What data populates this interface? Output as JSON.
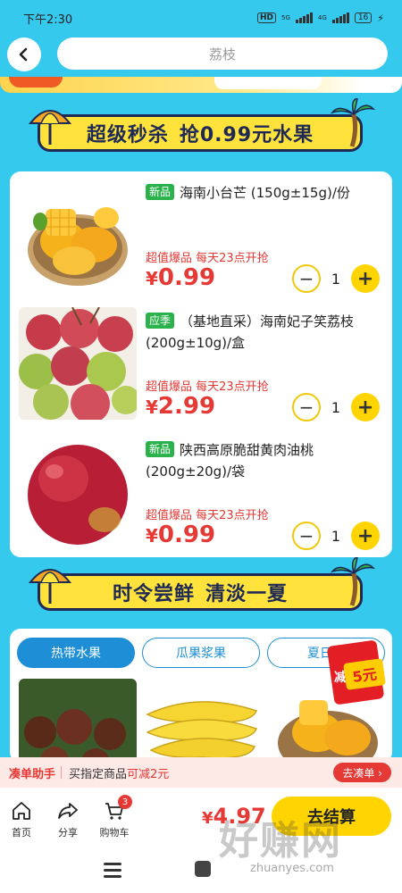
{
  "status_bar": {
    "time": "下午2:30",
    "network_hd": "HD",
    "net1": "5G",
    "net2": "4G",
    "battery": "16"
  },
  "header": {
    "search_text": "荔枝"
  },
  "section1": {
    "title_a": "超级秒杀",
    "title_b": "抢0.99元水果"
  },
  "products": [
    {
      "tag": "新品",
      "name": "海南小台芒 (150g±15g)/份",
      "promo": "超值爆品 每天23点开抢",
      "currency": "¥",
      "price": "0.99",
      "qty": "1",
      "tag_color": "#2bb24c"
    },
    {
      "tag": "应季",
      "name": "（基地直采）海南妃子笑荔枝(200g±10g)/盒",
      "promo": "超值爆品 每天23点开抢",
      "currency": "¥",
      "price": "2.99",
      "qty": "1",
      "tag_color": "#2bb24c"
    },
    {
      "tag": "新品",
      "name": "陕西高原脆甜黄肉油桃 (200g±20g)/袋",
      "promo": "超值爆品 每天23点开抢",
      "currency": "¥",
      "price": "0.99",
      "qty": "1",
      "tag_color": "#2bb24c"
    }
  ],
  "section2": {
    "title_a": "时令尝鲜",
    "title_b": "清淡一夏",
    "tabs": [
      "热带水果",
      "瓜果浆果",
      "夏日凉"
    ],
    "active_tab": 0
  },
  "coupon": {
    "label": "减",
    "amount": "5元"
  },
  "helper_bar": {
    "title": "凑单助手",
    "hint_prefix": "买指定商品",
    "hint_highlight": "可减2元",
    "go_label": "去凑单 ›"
  },
  "tab_bar": {
    "home": "首页",
    "share": "分享",
    "cart": "购物车",
    "cart_count": "3",
    "currency": "¥",
    "total": "4.97",
    "checkout": "去结算"
  },
  "watermark": {
    "text": "好赚网",
    "url": "zhuanyes.com"
  },
  "colors": {
    "background": "#35c9ee",
    "accent_yellow": "#ffd400",
    "price_red": "#e53935",
    "tab_blue": "#1e8fd6"
  }
}
